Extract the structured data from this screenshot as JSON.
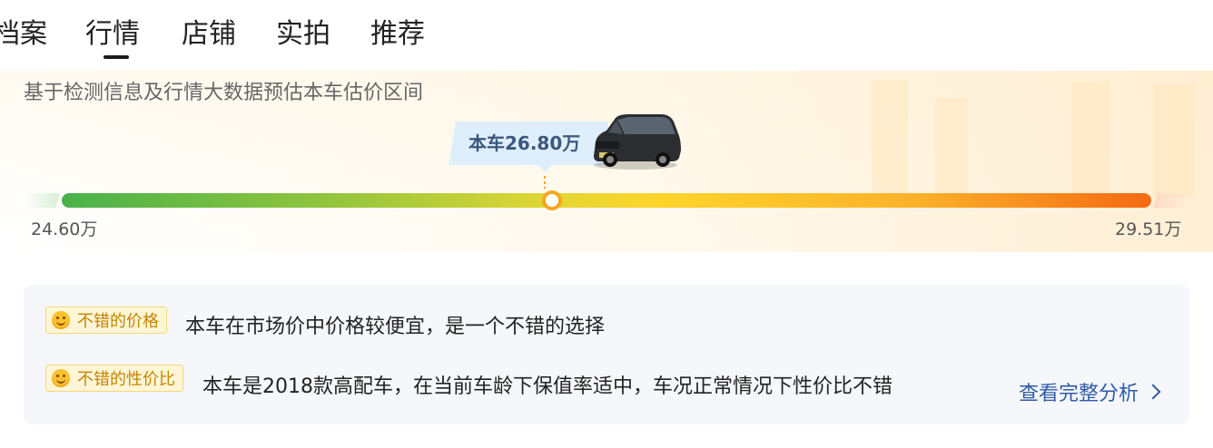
{
  "tabs": [
    {
      "label": "档案"
    },
    {
      "label": "行情",
      "active": true
    },
    {
      "label": "店铺"
    },
    {
      "label": "实拍"
    },
    {
      "label": "推荐"
    }
  ],
  "market": {
    "subtitle": "基于检测信息及行情大数据预估本车估价区间",
    "current_price_label": "本车26.80万",
    "range_min": "24.60万",
    "range_max": "29.51万",
    "marker_fraction": 0.45
  },
  "analysis": {
    "items": [
      {
        "tag": "不错的价格",
        "text": "本车在市场价中价格较便宜，是一个不错的选择"
      },
      {
        "tag": "不错的性价比",
        "text": "本车是2018款高配车，在当前车龄下保值率适中，车况正常情况下性价比不错"
      }
    ],
    "more_link": "查看完整分析"
  },
  "colors": {
    "gauge_start": "#49b24a",
    "gauge_mid": "#ffd42a",
    "gauge_end": "#f56a12",
    "tag_text": "#c58400",
    "link": "#2e5aa8"
  }
}
